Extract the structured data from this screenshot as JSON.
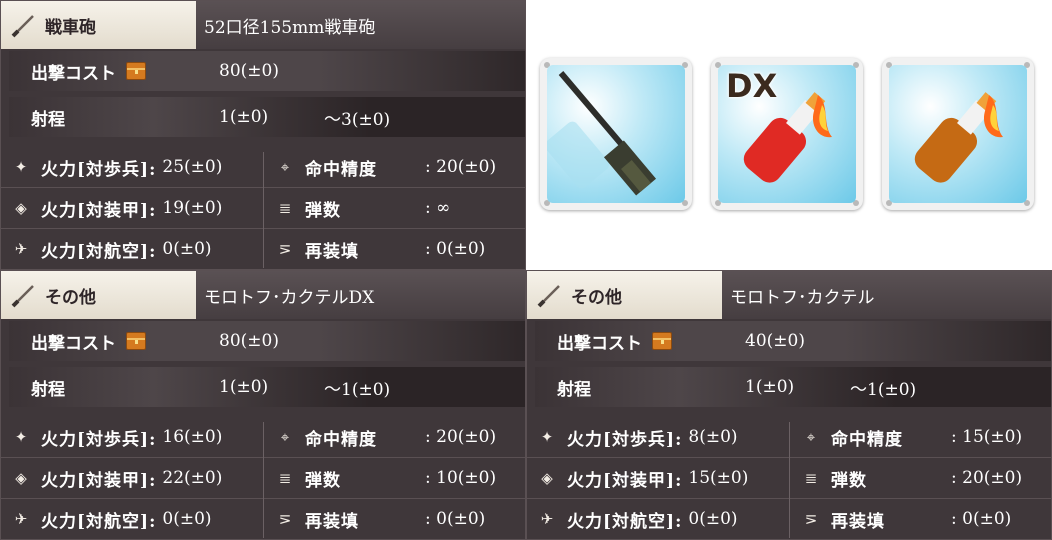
{
  "panels": [
    {
      "category": "戦車砲",
      "name": "52口径155mm戦車砲",
      "cost_label": "出撃コスト",
      "cost_value": "80(±0)",
      "range_label": "射程",
      "range_min": "1(±0)",
      "range_max": "～3(±0)",
      "stats_left": [
        {
          "label": "火力[対歩兵]:",
          "value": "25(±0)"
        },
        {
          "label": "火力[対装甲]:",
          "value": "19(±0)"
        },
        {
          "label": "火力[対航空]:",
          "value": "0(±0)"
        }
      ],
      "stats_right": [
        {
          "label": "命中精度",
          "value": ": 20(±0)"
        },
        {
          "label": "弾数",
          "value": ": ∞"
        },
        {
          "label": "再装填",
          "value": ": 0(±0)"
        }
      ]
    },
    {
      "category": "その他",
      "name": "モロトフ･カクテルDX",
      "cost_label": "出撃コスト",
      "cost_value": "80(±0)",
      "range_label": "射程",
      "range_min": "1(±0)",
      "range_max": "～1(±0)",
      "stats_left": [
        {
          "label": "火力[対歩兵]:",
          "value": "16(±0)"
        },
        {
          "label": "火力[対装甲]:",
          "value": "22(±0)"
        },
        {
          "label": "火力[対航空]:",
          "value": "0(±0)"
        }
      ],
      "stats_right": [
        {
          "label": "命中精度",
          "value": ": 20(±0)"
        },
        {
          "label": "弾数",
          "value": ": 10(±0)"
        },
        {
          "label": "再装填",
          "value": ": 0(±0)"
        }
      ]
    },
    {
      "category": "その他",
      "name": "モロトフ･カクテル",
      "cost_label": "出撃コスト",
      "cost_value": "40(±0)",
      "range_label": "射程",
      "range_min": "1(±0)",
      "range_max": "～1(±0)",
      "stats_left": [
        {
          "label": "火力[対歩兵]:",
          "value": "8(±0)"
        },
        {
          "label": "火力[対装甲]:",
          "value": "15(±0)"
        },
        {
          "label": "火力[対航空]:",
          "value": "0(±0)"
        }
      ],
      "stats_right": [
        {
          "label": "命中精度",
          "value": ": 15(±0)"
        },
        {
          "label": "弾数",
          "value": ": 20(±0)"
        },
        {
          "label": "再装填",
          "value": ": 0(±0)"
        }
      ]
    }
  ],
  "cards": [
    {
      "icon": "tank-gun-icon",
      "badge": ""
    },
    {
      "icon": "red-molotov-cocktail-icon",
      "badge": "DX"
    },
    {
      "icon": "orange-molotov-cocktail-icon",
      "badge": ""
    }
  ],
  "colors": {
    "panel_bg": "#3f373a",
    "header_tab": "#f6f2ea",
    "card_bg": "#6cc9e8"
  }
}
